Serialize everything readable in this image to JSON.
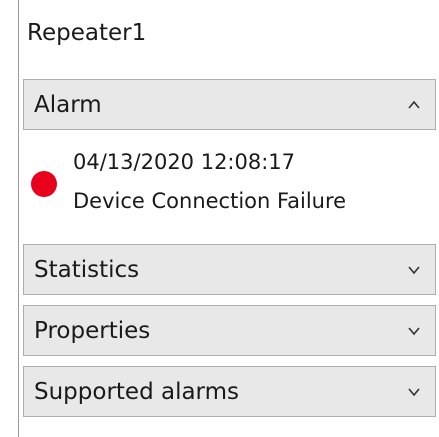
{
  "panel": {
    "title": "Repeater1"
  },
  "sections": [
    {
      "label": "Alarm",
      "expanded": true,
      "icon": "chevron-up-icon"
    },
    {
      "label": "Statistics",
      "expanded": false,
      "icon": "chevron-down-icon"
    },
    {
      "label": "Properties",
      "expanded": false,
      "icon": "chevron-down-icon"
    },
    {
      "label": "Supported alarms",
      "expanded": false,
      "icon": "chevron-down-icon"
    }
  ],
  "alarm": {
    "timestamp": "04/13/2020 12:08:17",
    "message": "Device Connection Failure",
    "status_color": "#e8001c",
    "status_icon": "status-dot-icon"
  },
  "colors": {
    "section_background": "#e8e8e8",
    "section_border": "#adadad"
  }
}
